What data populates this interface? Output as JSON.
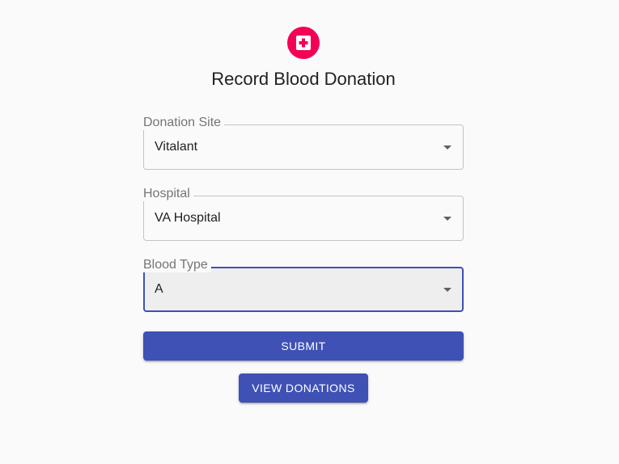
{
  "header": {
    "icon": "medical-cross-icon",
    "accent_color": "#f50057",
    "title": "Record Blood Donation"
  },
  "form": {
    "donation_site": {
      "label": "Donation Site",
      "value": "Vitalant"
    },
    "hospital": {
      "label": "Hospital",
      "value": "VA Hospital"
    },
    "blood_type": {
      "label": "Blood Type",
      "value": "A"
    }
  },
  "actions": {
    "submit_label": "Submit",
    "view_donations_label": "View Donations",
    "primary_color": "#3f51b5"
  }
}
